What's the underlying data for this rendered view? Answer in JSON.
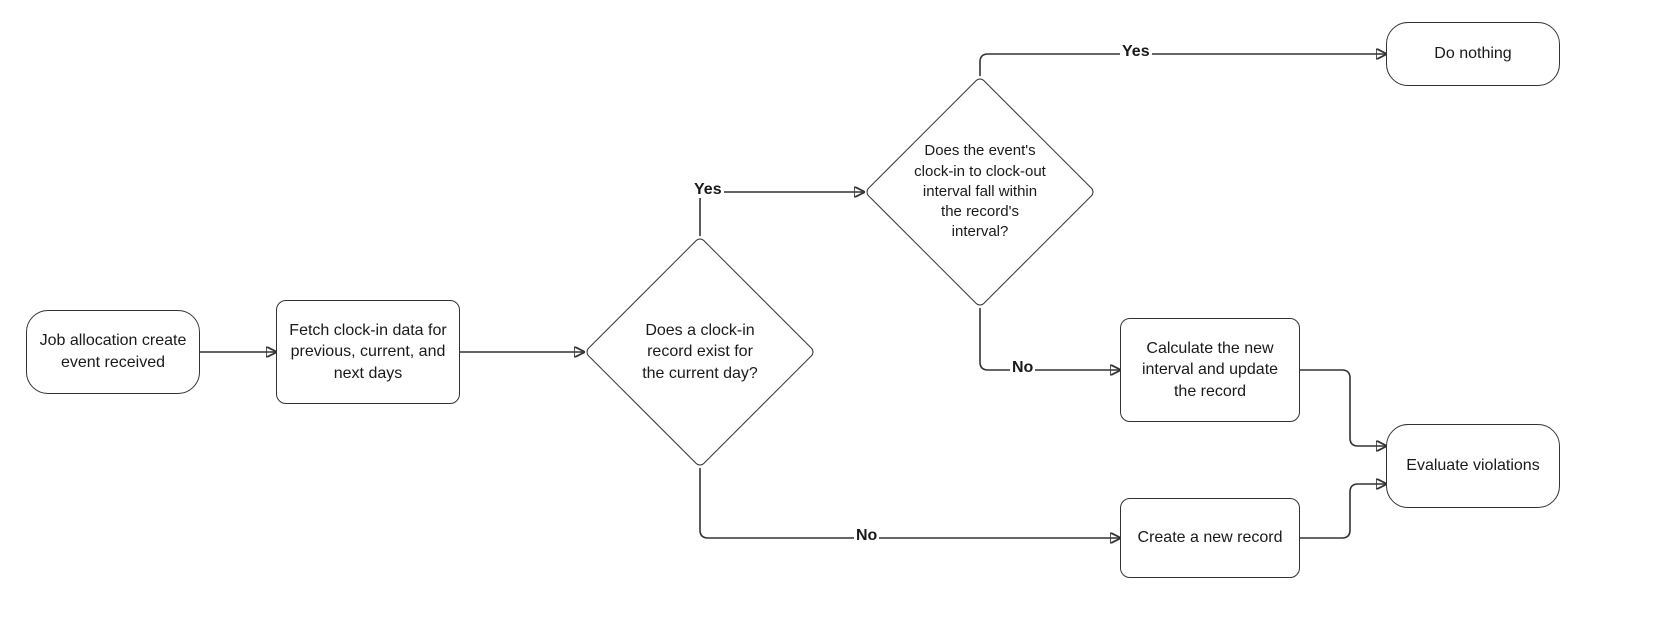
{
  "nodes": {
    "start": {
      "text": "Job allocation create event received"
    },
    "fetch": {
      "text": "Fetch clock-in data for previous, current, and next days"
    },
    "d1": {
      "text": "Does a clock-in record exist for the current day?"
    },
    "d2": {
      "text": "Does the event's clock-in to clock-out interval fall within the record's interval?"
    },
    "do_nothing": {
      "text": "Do nothing"
    },
    "calc_update": {
      "text": "Calculate the new interval and update the record"
    },
    "create_rec": {
      "text": "Create a new record"
    },
    "eval": {
      "text": "Evaluate violations"
    }
  },
  "labels": {
    "yes": "Yes",
    "no": "No"
  }
}
